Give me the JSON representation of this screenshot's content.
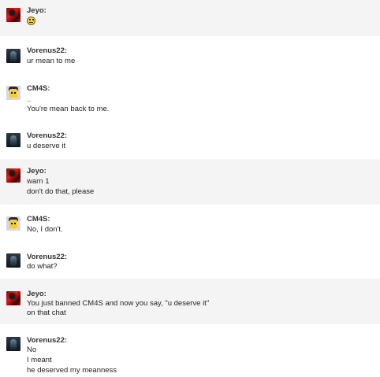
{
  "chat": {
    "messages": [
      {
        "author": "Jeyo:",
        "avatar": "red-bird-avatar",
        "emoji": "frowning-smiley-icon",
        "lines": []
      },
      {
        "author": "Vorenus22:",
        "avatar": "dark-hooded-avatar",
        "lines": [
          "ur mean to me"
        ]
      },
      {
        "author": "CM4S:",
        "avatar": "yellow-block-figure-avatar",
        "lines": [
          "..",
          "You're mean back to me."
        ]
      },
      {
        "author": "Vorenus22:",
        "avatar": "dark-hooded-avatar",
        "lines": [
          "u deserve it"
        ]
      },
      {
        "author": "Jeyo:",
        "avatar": "red-bird-avatar",
        "lines": [
          "warn 1",
          "don't do that, please"
        ]
      },
      {
        "author": "CM4S:",
        "avatar": "yellow-block-figure-avatar",
        "lines": [
          "No, I don't."
        ]
      },
      {
        "author": "Vorenus22:",
        "avatar": "dark-hooded-avatar",
        "lines": [
          "do what?"
        ]
      },
      {
        "author": "Jeyo:",
        "avatar": "red-bird-avatar",
        "lines": [
          "You just banned CM4S and now you say, \"u deserve it\"",
          "on that chat"
        ]
      },
      {
        "author": "Vorenus22:",
        "avatar": "dark-hooded-avatar",
        "lines": [
          "No",
          "I meant",
          "he deserved my meanness"
        ]
      }
    ]
  }
}
